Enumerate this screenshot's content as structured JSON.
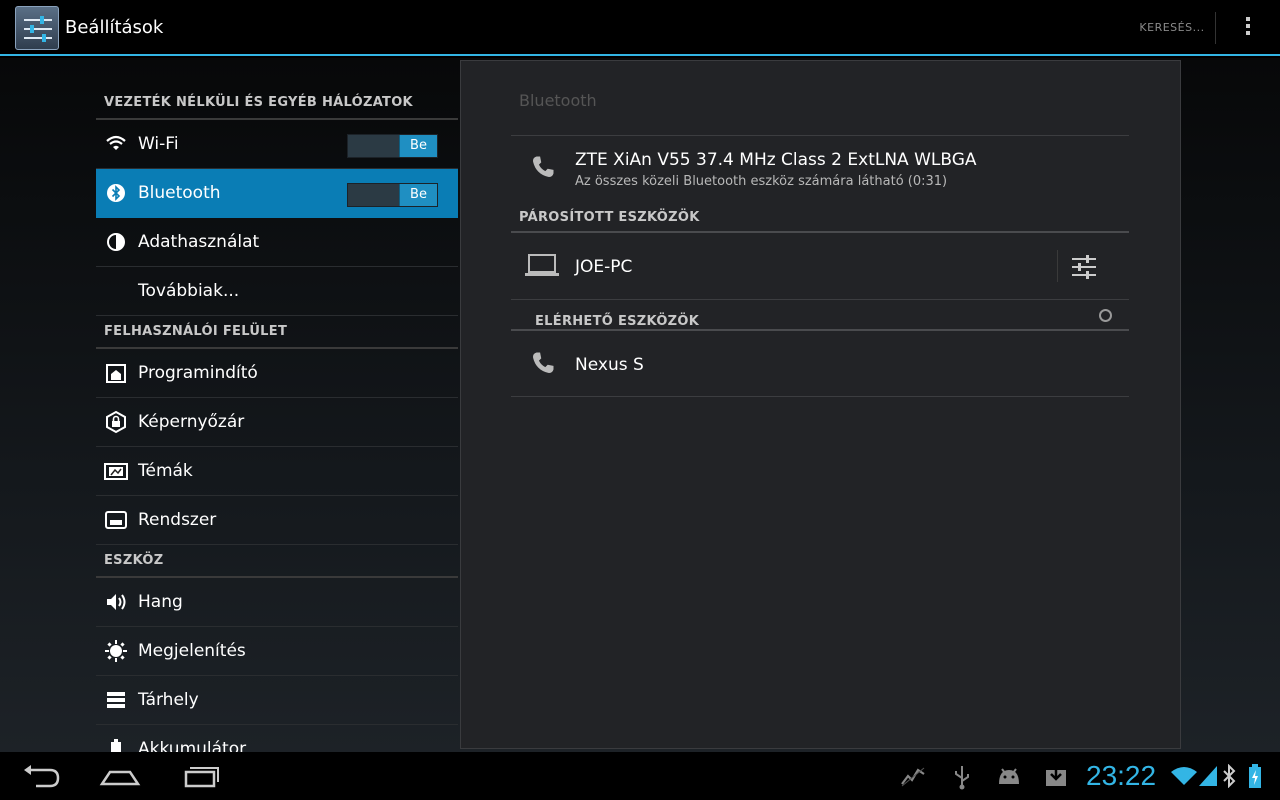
{
  "app": {
    "title": "Beállítások"
  },
  "actionbar": {
    "search_label": "KERESÉS..."
  },
  "left_list": {
    "sections": [
      {
        "header": "VEZETÉK NÉLKÜLI ÉS EGYÉB HÁLÓZATOK"
      },
      {
        "header": "FELHASZNÁLÓI FELÜLET"
      },
      {
        "header": "ESZKÖZ"
      }
    ],
    "items": [
      {
        "label": "Wi-Fi",
        "icon": "wifi-icon",
        "toggle": "Be"
      },
      {
        "label": "Bluetooth",
        "icon": "bluetooth-icon",
        "toggle": "Be",
        "selected": true
      },
      {
        "label": "Adathasználat",
        "icon": "data-usage-icon"
      },
      {
        "label": "Továbbiak...",
        "icon": ""
      },
      {
        "label": "Programindító",
        "icon": "launcher-icon"
      },
      {
        "label": "Képernyőzár",
        "icon": "lock-icon"
      },
      {
        "label": "Témák",
        "icon": "themes-icon"
      },
      {
        "label": "Rendszer",
        "icon": "system-icon"
      },
      {
        "label": "Hang",
        "icon": "sound-icon"
      },
      {
        "label": "Megjelenítés",
        "icon": "display-icon"
      },
      {
        "label": "Tárhely",
        "icon": "storage-icon"
      },
      {
        "label": "Akkumulátor",
        "icon": "battery-icon"
      }
    ]
  },
  "bluetooth_panel": {
    "title": "Bluetooth",
    "this_device": {
      "name": "ZTE XiAn V55 37.4 MHz Class 2 ExtLNA WLBGA",
      "status": "Az összes közeli Bluetooth eszköz számára látható (0:31)"
    },
    "paired_header": "PÁROSÍTOTT ESZKÖZÖK",
    "paired": [
      {
        "name": "JOE-PC",
        "icon": "laptop-icon"
      }
    ],
    "available_header": "ELÉRHETŐ ESZKÖZÖK",
    "available": [
      {
        "name": "Nexus S",
        "icon": "phone-icon"
      }
    ]
  },
  "statusbar": {
    "time": "23:22"
  },
  "colors": {
    "accent": "#33b5e5",
    "selected_bg": "#0a7db5"
  }
}
